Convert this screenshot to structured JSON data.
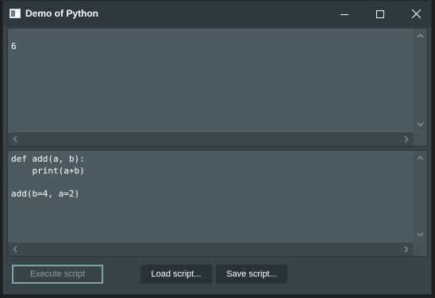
{
  "window": {
    "title": "Demo of Python"
  },
  "output": {
    "text": "6"
  },
  "editor": {
    "text": "def add(a, b):\n    print(a+b)\n\nadd(b=4, a=2)"
  },
  "buttons": {
    "execute_label": "Execute script",
    "load_label": "Load script...",
    "save_label": "Save script..."
  },
  "colors": {
    "window_bg": "#38444a",
    "panel_bg": "#4c5a61",
    "titlebar_bg": "#2d393e",
    "execute_border": "#7fa6a0"
  }
}
